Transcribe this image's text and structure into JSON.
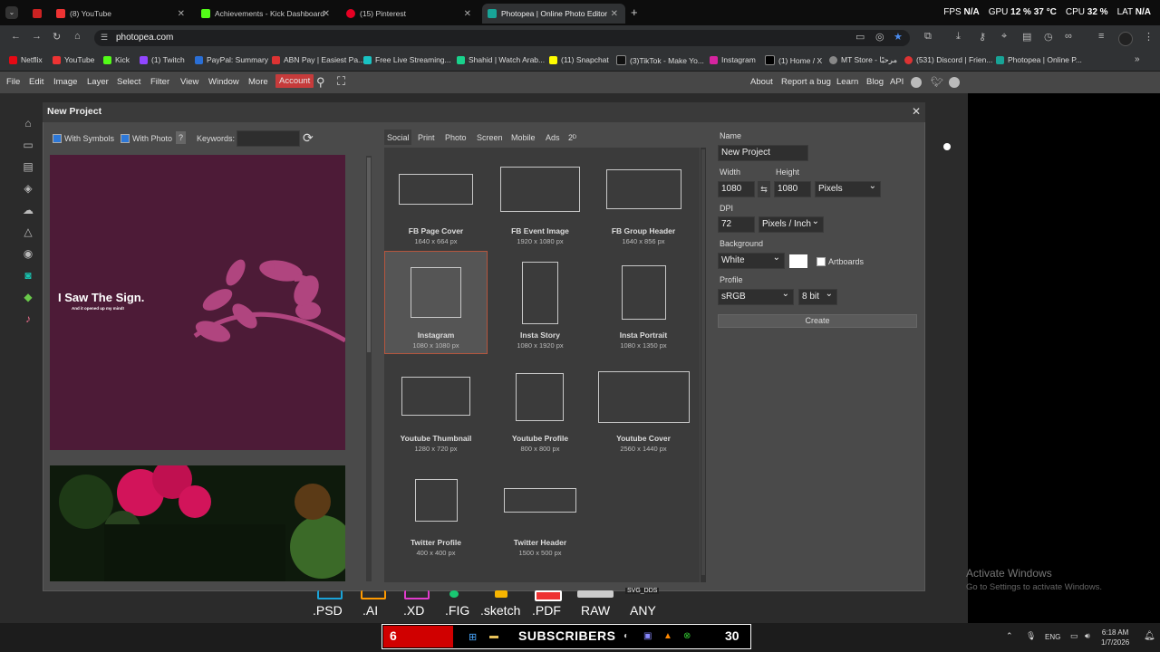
{
  "browser": {
    "tabs": [
      {
        "label": "(8) YouTube",
        "color": "#e33"
      },
      {
        "label": "Achievements - Kick Dashboard",
        "color": "#53fc18"
      },
      {
        "label": "(15) Pinterest",
        "color": "#e60023"
      },
      {
        "label": "Photopea | Online Photo Editor",
        "color": "#18a497",
        "active": true
      }
    ],
    "hud": {
      "fps_label": "FPS",
      "fps_value": "N/A",
      "gpu_label": "GPU",
      "gpu_value": "12 % 37 °C",
      "cpu_label": "CPU",
      "cpu_value": "32 %",
      "lat_label": "LAT",
      "lat_value": "N/A"
    },
    "url": "photopea.com",
    "bookmarks": [
      "Netflix",
      "YouTube",
      "Kick",
      "(1) Twitch",
      "PayPal: Summary",
      "ABN Pay | Easiest Pa...",
      "Free Live Streaming...",
      "Shahid | Watch Arab...",
      "(11) Snapchat",
      "(3)TikTok - Make Yo...",
      "Instagram",
      "(1) Home / X",
      "MT Store - مرحبًا",
      "(531) Discord | Frien...",
      "Photopea | Online P..."
    ]
  },
  "menu": {
    "items": [
      "File",
      "Edit",
      "Image",
      "Layer",
      "Select",
      "Filter",
      "View",
      "Window",
      "More"
    ],
    "account": "Account",
    "right_links": [
      "About",
      "Report a bug",
      "Learn",
      "Blog",
      "API"
    ]
  },
  "dialog": {
    "title": "New Project",
    "with_symbols": "With Symbols",
    "with_photo": "With Photo",
    "help": "?",
    "keywords_label": "Keywords:",
    "template_title": "I Saw The Sign.",
    "template_subtitle": "And it opened up my mind!",
    "preset_tabs": [
      "Social",
      "Print",
      "Photo",
      "Screen",
      "Mobile",
      "Ads",
      "2ᴰ"
    ],
    "presets": [
      {
        "name": "FB Page Cover",
        "size": "1640 x 664 px"
      },
      {
        "name": "FB Event Image",
        "size": "1920 x 1080 px"
      },
      {
        "name": "FB Group Header",
        "size": "1640 x 856 px"
      },
      {
        "name": "Instagram",
        "size": "1080 x 1080 px"
      },
      {
        "name": "Insta Story",
        "size": "1080 x 1920 px"
      },
      {
        "name": "Insta Portrait",
        "size": "1080 x 1350 px"
      },
      {
        "name": "Youtube Thumbnail",
        "size": "1280 x 720 px"
      },
      {
        "name": "Youtube Profile",
        "size": "800 x 800 px"
      },
      {
        "name": "Youtube Cover",
        "size": "2560 x 1440 px"
      },
      {
        "name": "Twitter Profile",
        "size": "400 x 400 px"
      },
      {
        "name": "Twitter Header",
        "size": "1500 x 500 px"
      }
    ],
    "form": {
      "name_label": "Name",
      "name_value": "New Project",
      "width_label": "Width",
      "width_value": "1080",
      "height_label": "Height",
      "height_value": "1080",
      "unit": "Pixels",
      "dpi_label": "DPI",
      "dpi_value": "72",
      "dpi_unit": "Pixels / Inch",
      "background_label": "Background",
      "background_value": "White",
      "artboards": "Artboards",
      "profile_label": "Profile",
      "profile_value": "sRGB",
      "bits": "8 bit",
      "create": "Create"
    }
  },
  "watermark": {
    "line1": "Activate Windows",
    "line2": "Go to Settings to activate Windows."
  },
  "formats": [
    ".PSD",
    ".AI",
    ".XD",
    ".FIG",
    ".sketch",
    ".PDF",
    "RAW",
    "ANY"
  ],
  "formats_caption": "SVG_DDS",
  "overlay": {
    "number": "6",
    "text": "SUBSCRIBERS",
    "count": "30"
  },
  "taskbar": {
    "lang": "ENG",
    "time": "6:18 AM",
    "date": "1/7/2026"
  }
}
